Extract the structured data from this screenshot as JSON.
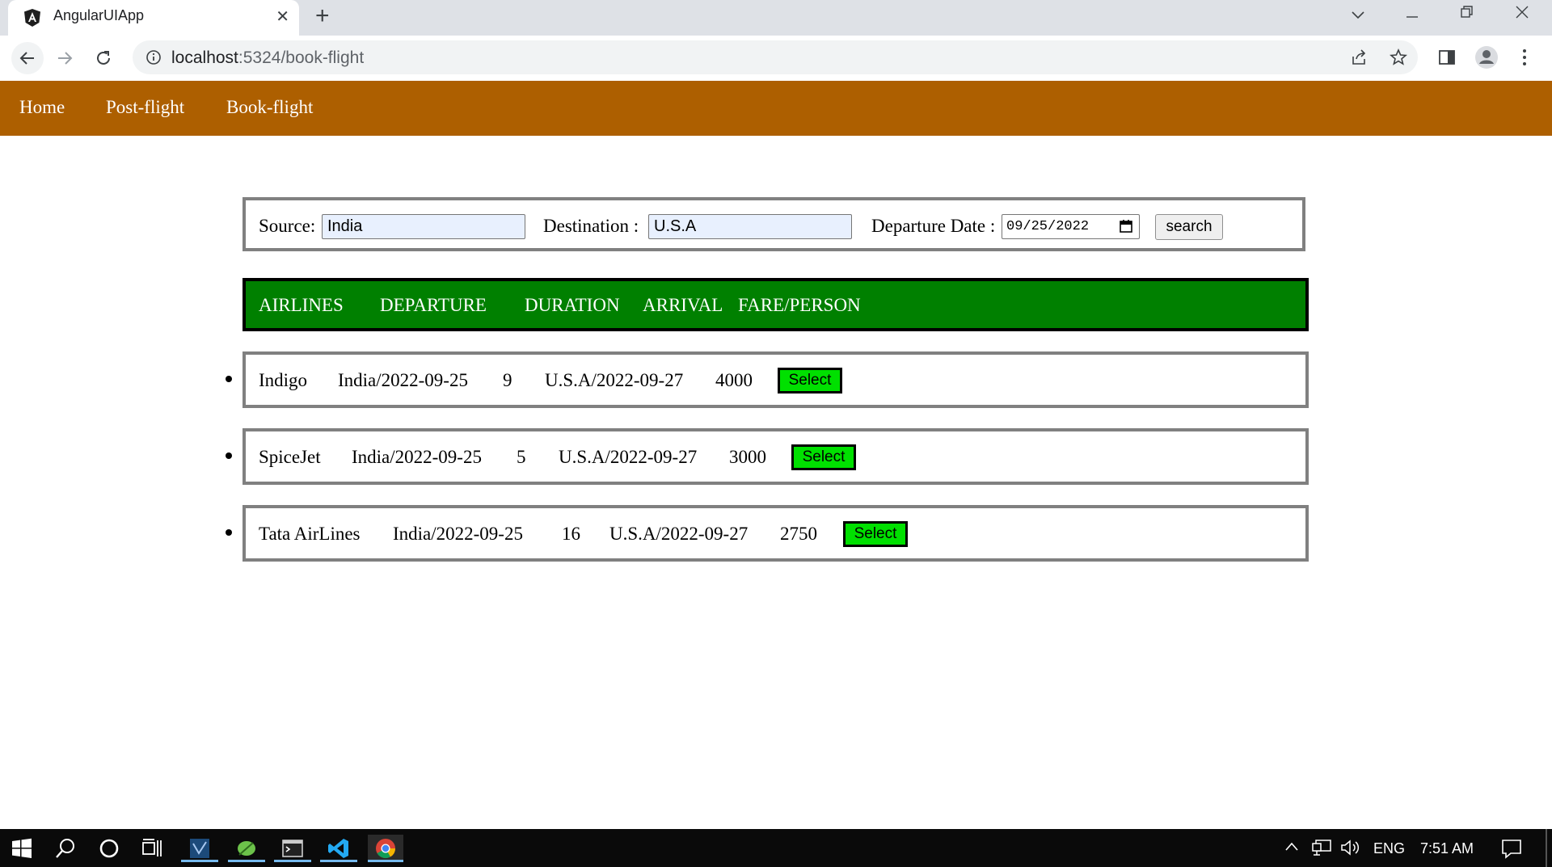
{
  "browser": {
    "tab_title": "AngularUIApp",
    "url_host": "localhost",
    "url_path": ":5324/book-flight",
    "new_tab_label": "+",
    "close_tab_label": "✕"
  },
  "app_nav": {
    "items": [
      "Home",
      "Post-flight",
      "Book-flight"
    ],
    "background": "#ad5f00"
  },
  "search": {
    "source_label": "Source:",
    "source_value": "India",
    "destination_label": "Destination :",
    "destination_value": "U.S.A",
    "date_label": "Departure Date :",
    "date_value": "09/25/2022",
    "button_label": "search"
  },
  "table_header": {
    "columns": [
      "AIRLINES",
      "DEPARTURE",
      "DURATION",
      "ARRIVAL",
      "FARE/PERSON"
    ],
    "background": "#008000"
  },
  "flights": [
    {
      "airline": "Indigo",
      "departure": "India/2022-09-25",
      "duration": "9",
      "arrival": "U.S.A/2022-09-27",
      "fare": "4000",
      "button": "Select"
    },
    {
      "airline": "SpiceJet",
      "departure": "India/2022-09-25",
      "duration": "5",
      "arrival": "U.S.A/2022-09-27",
      "fare": "3000",
      "button": "Select"
    },
    {
      "airline": "Tata AirLines",
      "departure": "India/2022-09-25",
      "duration": "16",
      "arrival": "U.S.A/2022-09-27",
      "fare": "2750",
      "button": "Select"
    }
  ],
  "select_button_color": "#00e000",
  "taskbar": {
    "language": "ENG",
    "time": "7:51 AM"
  }
}
